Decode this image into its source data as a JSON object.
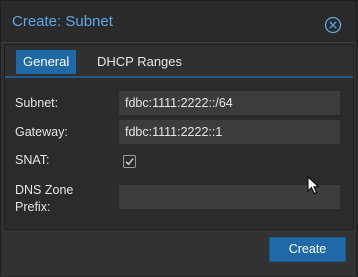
{
  "dialog": {
    "title": "Create: Subnet",
    "tabs": [
      {
        "label": "General",
        "active": true
      },
      {
        "label": "DHCP Ranges",
        "active": false
      }
    ],
    "fields": {
      "subnet": {
        "label": "Subnet:",
        "value": "fdbc:1111:2222::/64"
      },
      "gateway": {
        "label": "Gateway:",
        "value": "fdbc:1111:2222::1"
      },
      "snat": {
        "label": "SNAT:",
        "checked": true
      },
      "dns_zone_prefix": {
        "label_line1": "DNS Zone",
        "label_line2": "Prefix:",
        "value": ""
      }
    },
    "create_label": "Create"
  },
  "colors": {
    "accent": "#1f6aa6",
    "title_text": "#5aa8e8",
    "background": "#323232"
  }
}
